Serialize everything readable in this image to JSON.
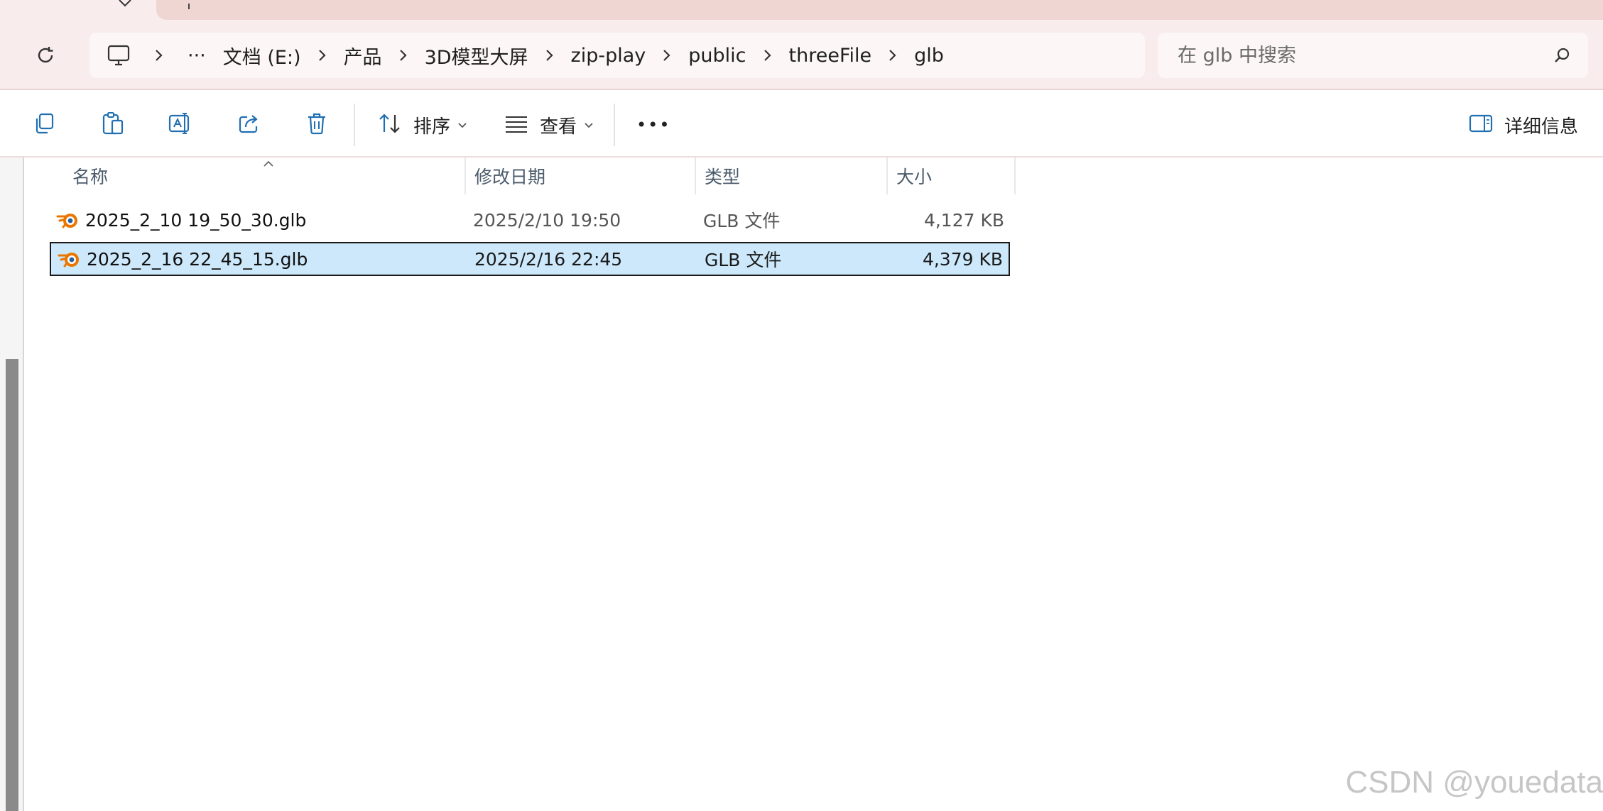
{
  "address": {
    "overflow_label": "···",
    "crumbs": [
      "文档 (E:)",
      "产品",
      "3D模型大屏",
      "zip-play",
      "public",
      "threeFile",
      "glb"
    ]
  },
  "search": {
    "placeholder": "在 glb 中搜索"
  },
  "commandbar": {
    "sort_label": "排序",
    "view_label": "查看",
    "more_label": "•••",
    "details_label": "详细信息"
  },
  "columns": {
    "name": "名称",
    "date": "修改日期",
    "type": "类型",
    "size": "大小"
  },
  "files": [
    {
      "name": "2025_2_10 19_50_30.glb",
      "date": "2025/2/10 19:50",
      "type": "GLB 文件",
      "size": "4,127 KB",
      "selected": false
    },
    {
      "name": "2025_2_16 22_45_15.glb",
      "date": "2025/2/16 22:45",
      "type": "GLB 文件",
      "size": "4,379 KB",
      "selected": true
    }
  ],
  "icons": {
    "tab_close": "close-icon",
    "tab_add": "plus-icon",
    "refresh": "refresh-icon",
    "computer": "computer-icon",
    "search": "search-icon",
    "copy": "copy-icon",
    "paste": "paste-icon",
    "rename": "rename-icon",
    "share": "share-icon",
    "delete": "trash-icon",
    "sort": "sort-icon",
    "view": "view-icon",
    "details": "details-pane-icon",
    "file": "blender-file-icon"
  },
  "colors": {
    "titlebar_bg": "#f9ecec",
    "selection_bg": "#cce8fa",
    "accent_icon": "#1f6fb2",
    "blender_orange": "#ea7600"
  },
  "watermark": "CSDN @youedata"
}
